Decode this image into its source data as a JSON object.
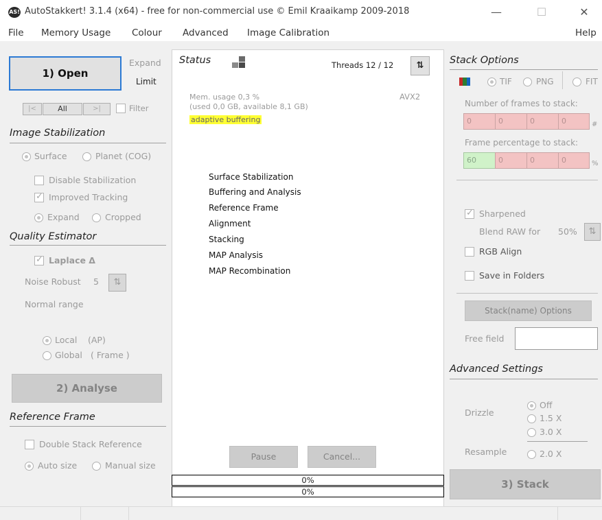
{
  "window": {
    "title": "AutoStakkert! 3.1.4 (x64) - free for non-commercial use © Emil Kraaikamp 2009-2018",
    "icon_text": "AS!",
    "minimize": "—",
    "maximize": "☐",
    "close": "✕"
  },
  "menu": [
    "File",
    "Memory Usage",
    "Colour",
    "Advanced",
    "Image Calibration"
  ],
  "menu_help": "Help",
  "left": {
    "open_label": "1) Open",
    "expand_label": "Expand",
    "limit_label": "Limit",
    "nav_first": "|<",
    "nav_all": "All",
    "nav_last": ">|",
    "filter_label": "Filter",
    "image_stabilization": {
      "title": "Image Stabilization",
      "surface": "Surface",
      "planet": "Planet (COG)",
      "disable": "Disable Stabilization",
      "improved": "Improved Tracking",
      "expand": "Expand",
      "cropped": "Cropped"
    },
    "quality_estimator": {
      "title": "Quality Estimator",
      "laplace": "Laplace Δ",
      "noise_robust": "Noise Robust",
      "noise_value": "5",
      "normal_range": "Normal range",
      "local": "Local",
      "local_suffix": "(AP)",
      "global": "Global",
      "global_suffix": "( Frame )"
    },
    "analyse_label": "2) Analyse",
    "reference_frame": {
      "title": "Reference Frame",
      "double_stack": "Double Stack Reference",
      "auto_size": "Auto size",
      "manual_size": "Manual size"
    }
  },
  "center": {
    "status_title": "Status",
    "threads_label": "Threads 12 / 12",
    "avx_label": "AVX2",
    "mem_usage": "Mem. usage 0,3 %",
    "mem_detail": "(used 0,0 GB, available 8,1 GB)",
    "buffering": "adaptive buffering",
    "steps": [
      "Surface Stabilization",
      "Buffering and Analysis",
      "Reference Frame",
      "Alignment",
      "Stacking",
      "MAP Analysis",
      "MAP Recombination"
    ],
    "pause_label": "Pause",
    "cancel_label": "Cancel...",
    "progress1": "0%",
    "progress2": "0%",
    "progress1_value": 0,
    "progress2_value": 0
  },
  "right": {
    "stack_options_title": "Stack Options",
    "format_tif": "TIF",
    "format_png": "PNG",
    "format_fit": "FIT",
    "frames_label": "Number of frames to stack:",
    "frames_values": [
      "0",
      "0",
      "0",
      "0"
    ],
    "frames_suffix": "#",
    "percent_label": "Frame percentage to stack:",
    "percent_values": [
      "60",
      "0",
      "0",
      "0"
    ],
    "percent_suffix": "%",
    "sharpened": "Sharpened",
    "blend_raw": "Blend RAW for",
    "blend_value": "50%",
    "rgb_align": "RGB Align",
    "save_folders": "Save in Folders",
    "stackname_options": "Stack(name) Options",
    "free_field_label": "Free field",
    "free_field_value": "",
    "advanced_title": "Advanced Settings",
    "drizzle_label": "Drizzle",
    "drizzle_off": "Off",
    "drizzle_15": "1.5 X",
    "drizzle_30": "3.0 X",
    "resample_label": "Resample",
    "resample_20": "2.0 X",
    "stack_label": "3) Stack"
  },
  "colors": {
    "highlight": "#ffff33",
    "field_red": "#f3c3c3",
    "field_green": "#d0f2c9",
    "open_border": "#2b79d4"
  }
}
